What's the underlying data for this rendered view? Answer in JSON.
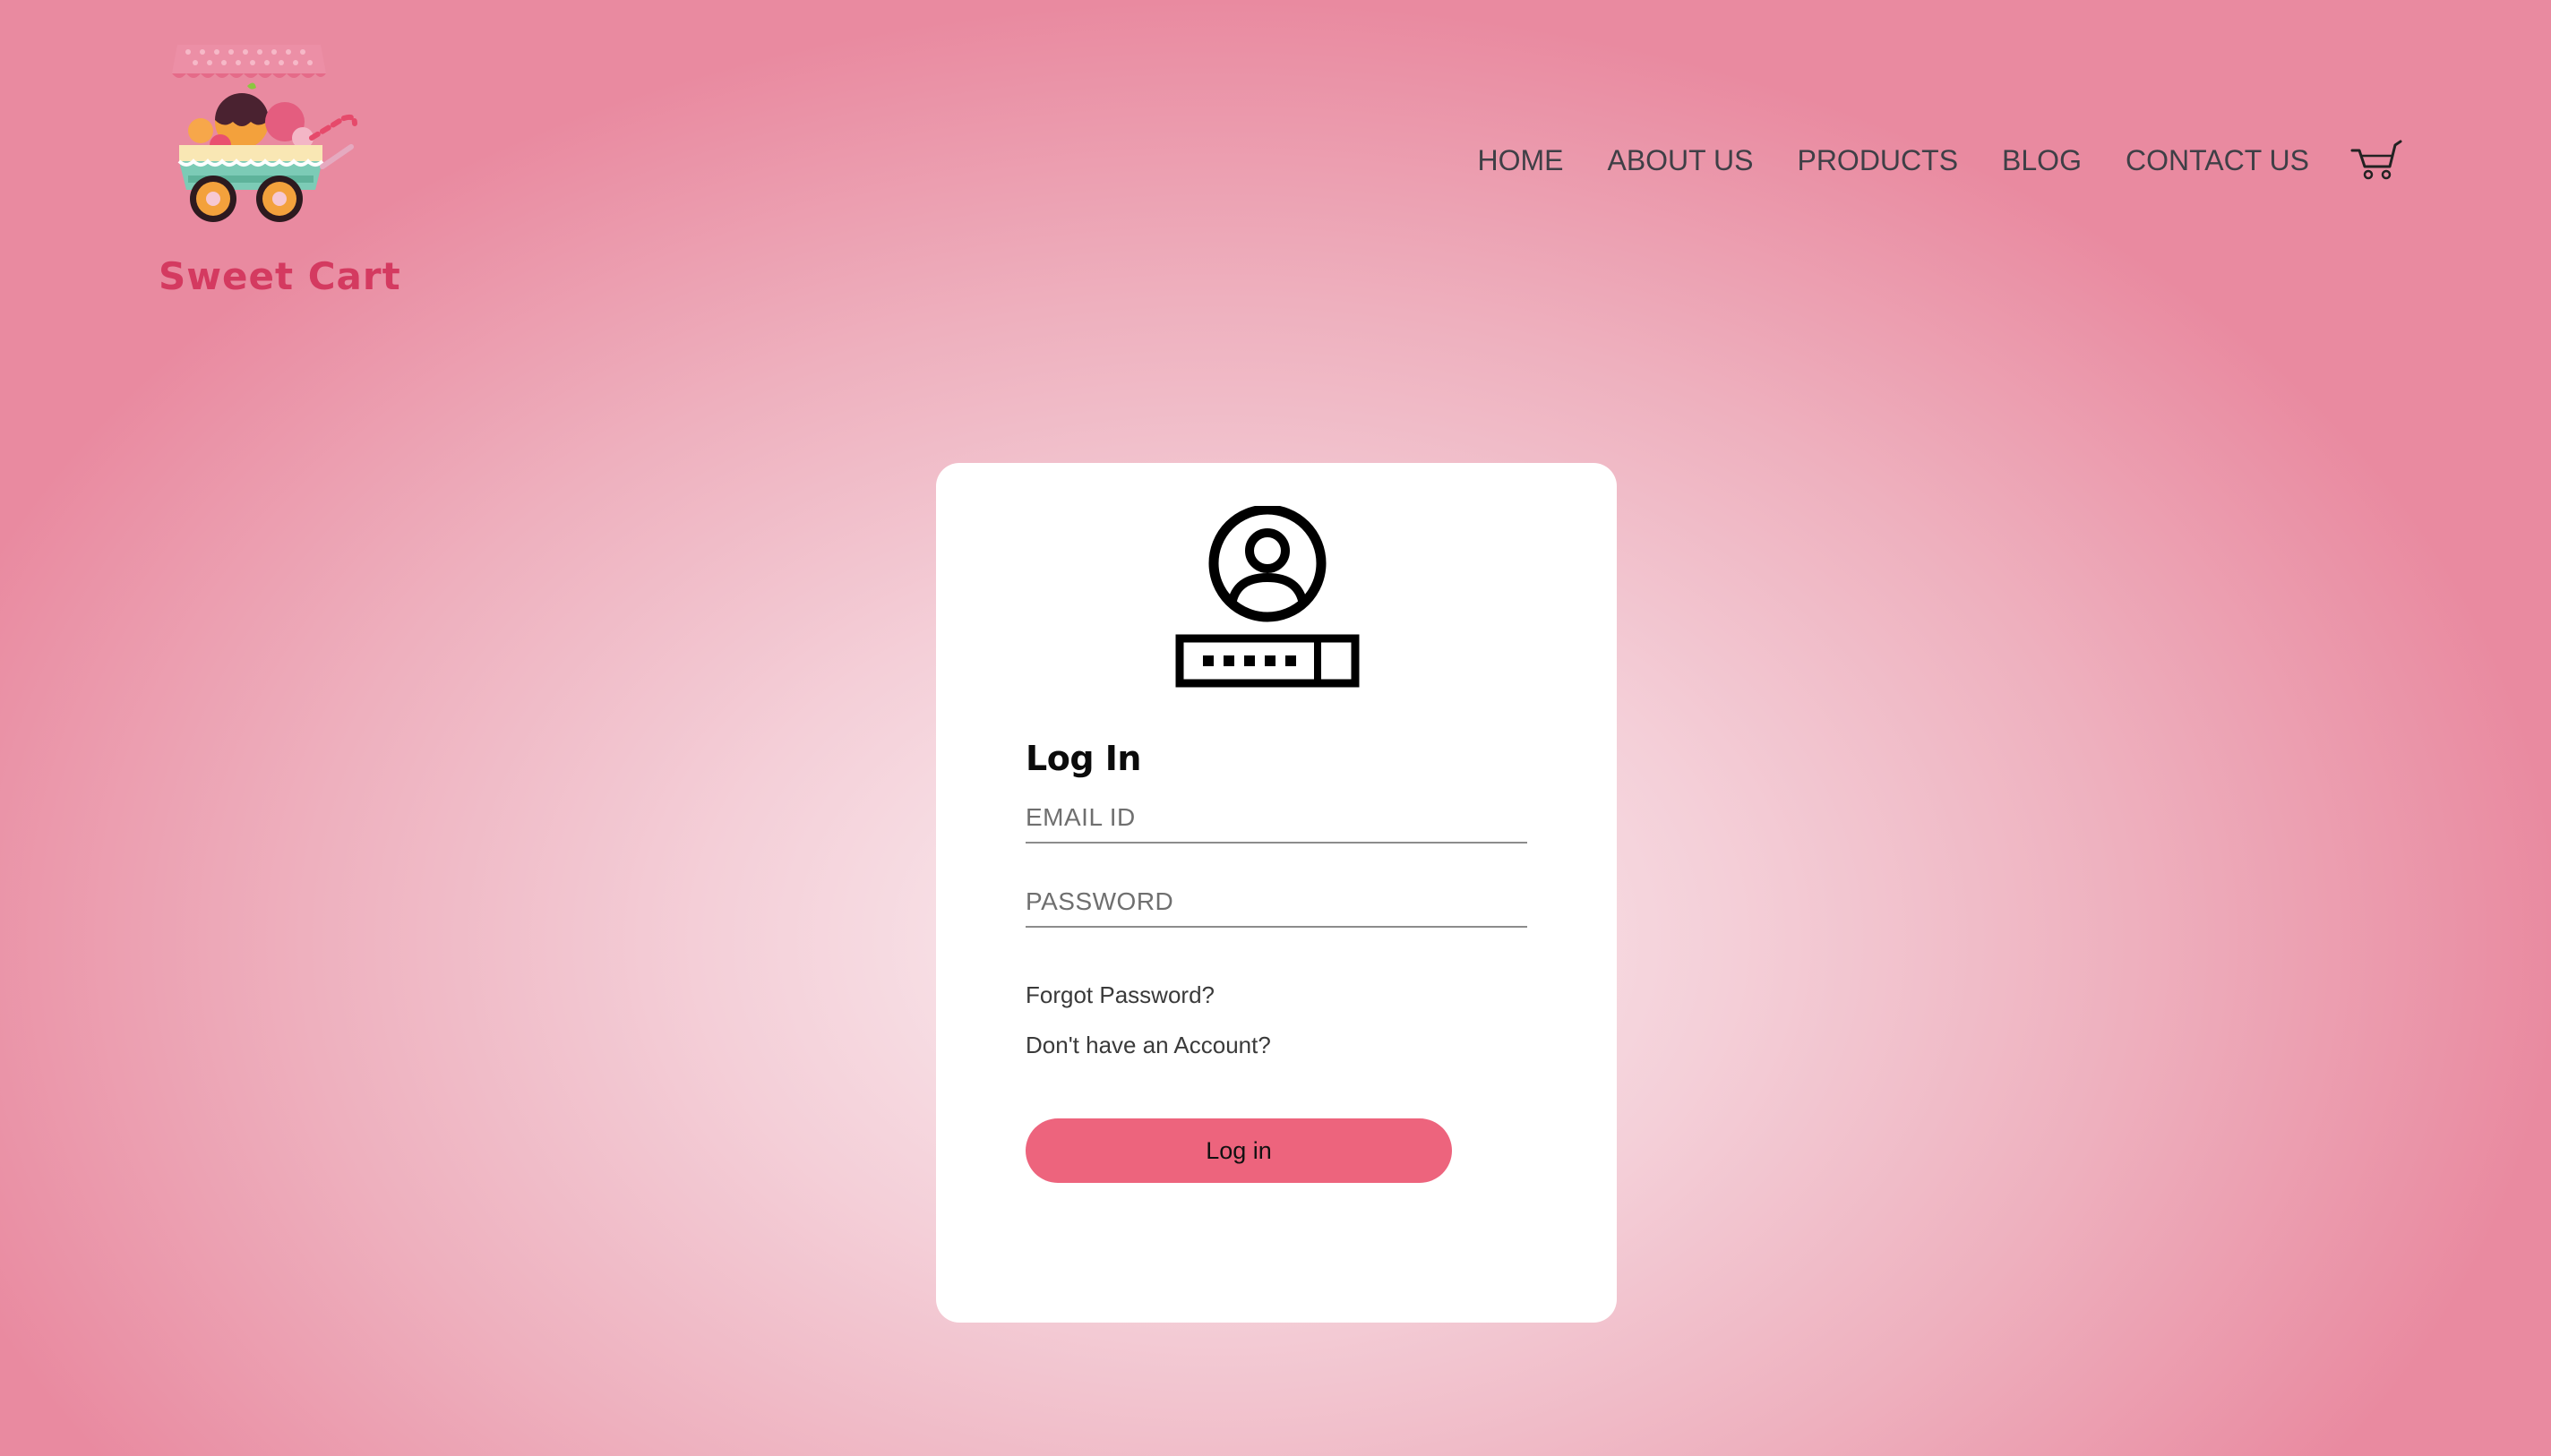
{
  "brand": {
    "name": "Sweet Cart",
    "logo_icon": "candy-cart-logo"
  },
  "nav": {
    "items": [
      {
        "label": "HOME"
      },
      {
        "label": "ABOUT US"
      },
      {
        "label": "PRODUCTS"
      },
      {
        "label": "BLOG"
      },
      {
        "label": "CONTACT US"
      }
    ],
    "cart_icon": "shopping-cart-icon"
  },
  "login": {
    "icon": "user-password-login-icon",
    "title": "Log In",
    "email_placeholder": "EMAIL ID",
    "email_value": "",
    "password_placeholder": "PASSWORD",
    "password_value": "",
    "forgot_password": "Forgot Password?",
    "no_account": "Don't have an Account?",
    "submit_label": "Log in"
  },
  "colors": {
    "accent": "#ed647d",
    "brand_text": "#d43a60",
    "background_center": "#fbeff2",
    "background_edge": "#e98aa0",
    "card": "#ffffff"
  }
}
